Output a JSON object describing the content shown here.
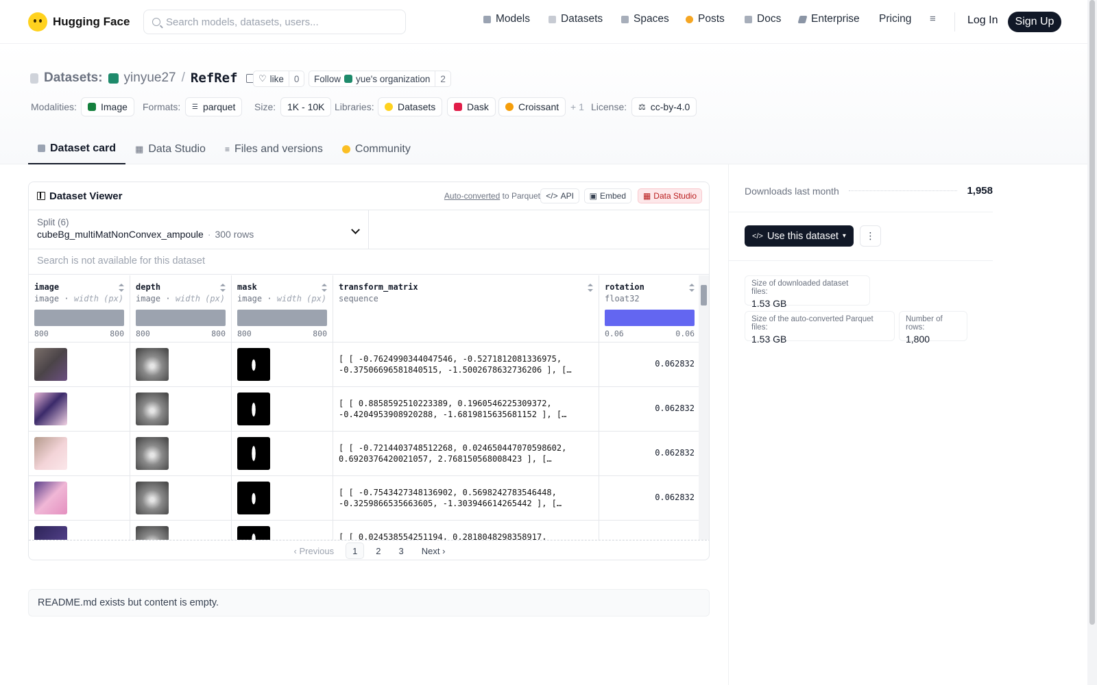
{
  "header": {
    "brand": "Hugging Face",
    "search_placeholder": "Search models, datasets, users...",
    "nav": [
      {
        "label": "Models",
        "icon": "models-icon",
        "color": "#9aa3b2"
      },
      {
        "label": "Datasets",
        "icon": "datasets-icon",
        "color": "#c7cbd3"
      },
      {
        "label": "Spaces",
        "icon": "spaces-icon",
        "color": "#a7aeba"
      },
      {
        "label": "Posts",
        "icon": "posts-icon",
        "color": "#f5a623"
      },
      {
        "label": "Docs",
        "icon": "docs-icon",
        "color": "#a7aeba"
      },
      {
        "label": "Enterprise",
        "icon": "enterprise-icon",
        "color": "#8b95a5"
      },
      {
        "label": "Pricing"
      }
    ],
    "login": "Log In",
    "signup": "Sign Up"
  },
  "repo": {
    "type_label": "Datasets:",
    "owner": "yinyue27",
    "separator": "/",
    "name": "RefRef",
    "like_label": "like",
    "like_count": "0",
    "follow_label": "Follow",
    "org_name": "yue's organization",
    "follow_count": "2"
  },
  "meta": {
    "modalities_label": "Modalities:",
    "modality": "Image",
    "formats_label": "Formats:",
    "format": "parquet",
    "size_label": "Size:",
    "size": "1K - 10K",
    "libraries_label": "Libraries:",
    "libraries": [
      "Datasets",
      "Dask",
      "Croissant"
    ],
    "libraries_more": "+ 1",
    "license_label": "License:",
    "license": "cc-by-4.0"
  },
  "tabs": [
    {
      "label": "Dataset card",
      "active": true
    },
    {
      "label": "Data Studio"
    },
    {
      "label": "Files and versions"
    },
    {
      "label": "Community"
    }
  ],
  "viewer": {
    "title": "Dataset Viewer",
    "auto_converted": "Auto-converted",
    "to_parquet": "to Parquet",
    "api_label": "API",
    "embed_label": "Embed",
    "studio_label": "Data Studio",
    "split_label": "Split (6)",
    "split_value": "cubeBg_multiMatNonConvex_ampoule",
    "split_rows": "300 rows",
    "search_placeholder": "Search is not available for this dataset",
    "columns": [
      {
        "name": "image",
        "type": "image",
        "sub": "width (px)",
        "min": "800",
        "max": "800",
        "hist_color": "#9ca3af"
      },
      {
        "name": "depth",
        "type": "image",
        "sub": "width (px)",
        "min": "800",
        "max": "800",
        "hist_color": "#9ca3af"
      },
      {
        "name": "mask",
        "type": "image",
        "sub": "width (px)",
        "min": "800",
        "max": "800",
        "hist_color": "#9ca3af"
      },
      {
        "name": "transform_matrix",
        "type": "sequence"
      },
      {
        "name": "rotation",
        "type": "float32",
        "min": "0.06",
        "max": "0.06",
        "hist_color": "#6366f1"
      }
    ],
    "rows": [
      {
        "matrix": "[ [ -0.7624990344047546, -0.5271812081336975,\n-0.37506696581840515, -1.5002678632736206 ], […",
        "rotation": "0.062832"
      },
      {
        "matrix": "[ [ 0.8858592510223389, 0.1960546225309372,\n-0.4204953908920288, -1.6819815635681152 ], […",
        "rotation": "0.062832"
      },
      {
        "matrix": "[ [ -0.7214403748512268, 0.024650447070598602,\n0.6920376420021057, 2.768150568008423 ], […",
        "rotation": "0.062832"
      },
      {
        "matrix": "[ [ -0.7543427348136902, 0.5698242783546448,\n-0.3259866535663605, -1.303946614265442 ], […",
        "rotation": "0.062832"
      },
      {
        "matrix": "[ [ 0.024538554251194, 0.2818048298358917,",
        "rotation": ""
      }
    ],
    "pager": {
      "prev": "Previous",
      "pages": [
        "1",
        "2",
        "3"
      ],
      "next": "Next"
    }
  },
  "readme_text": "README.md exists but content is empty.",
  "sidebar": {
    "downloads_label": "Downloads last month",
    "downloads_value": "1,958",
    "use_button": "Use this dataset",
    "more": "⋮",
    "stats": [
      {
        "label": "Size of downloaded dataset files:",
        "value": "1.53 GB"
      },
      {
        "label": "Size of the auto-converted Parquet files:",
        "value": "1.53 GB"
      },
      {
        "label": "Number of rows:",
        "value": "1,800"
      }
    ]
  }
}
